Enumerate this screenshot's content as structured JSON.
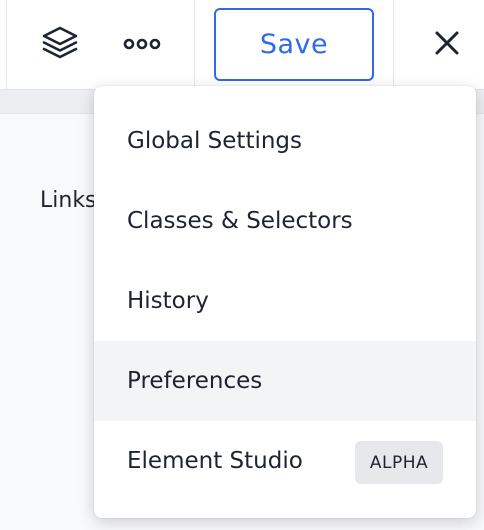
{
  "toolbar": {
    "layers_icon": "layers-icon",
    "more_icon": "more-options-icon",
    "save_label": "Save",
    "close_icon": "close-icon",
    "accent_color": "#2e6be6"
  },
  "content": {
    "label": "Links"
  },
  "menu": {
    "items": [
      {
        "label": "Global Settings"
      },
      {
        "label": "Classes & Selectors"
      },
      {
        "label": "History"
      },
      {
        "label": "Preferences",
        "state": "hovered"
      },
      {
        "label": "Element Studio",
        "badge": "ALPHA"
      }
    ]
  }
}
